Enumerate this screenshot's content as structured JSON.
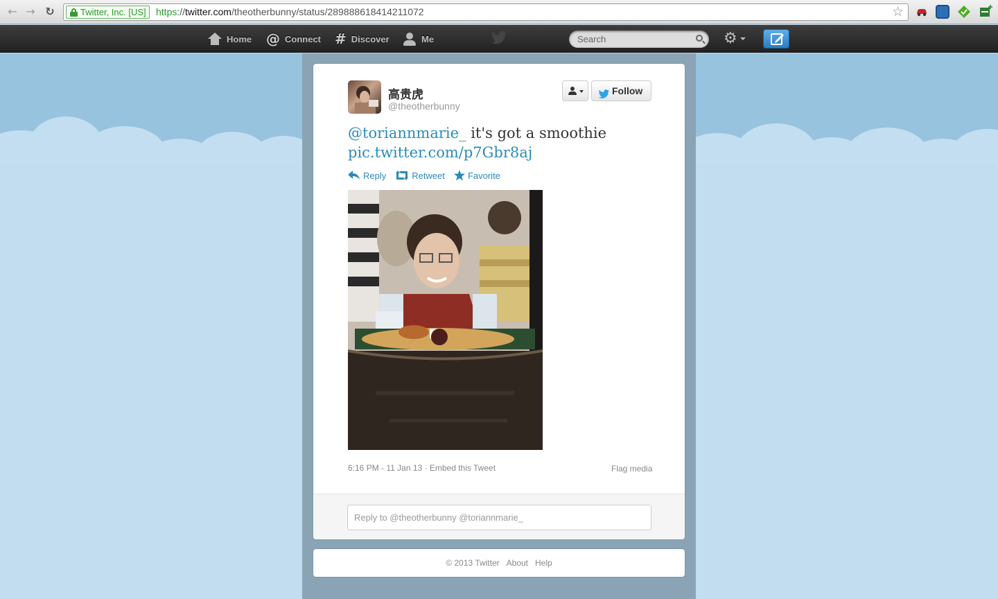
{
  "browser": {
    "ev_label": "Twitter, Inc. [US]",
    "url_scheme": "https",
    "url_sep": "://",
    "url_host": "twitter.com",
    "url_path": "/theotherbunny/status/289888618414211072"
  },
  "topnav": {
    "home": "Home",
    "connect": "Connect",
    "discover": "Discover",
    "me": "Me",
    "search_placeholder": "Search"
  },
  "tweet": {
    "fullname": "高贵虎",
    "screen_name": "@theotherbunny",
    "follow_label": "Follow",
    "mention": "@toriannmarie_",
    "text": " it's got a smoothie",
    "link": "pic.twitter.com/p7Gbr8aj",
    "actions": {
      "reply": "Reply",
      "retweet": "Retweet",
      "favorite": "Favorite"
    },
    "timestamp": "6:16 PM - 11 Jan 13",
    "separator": " · ",
    "embed": "Embed this Tweet",
    "flag": "Flag media",
    "reply_placeholder": "Reply to @theotherbunny @toriannmarie_"
  },
  "footer": {
    "copyright": "© 2013 Twitter",
    "about": "About",
    "help": "Help"
  },
  "colors": {
    "link_blue": "#2b8ab8",
    "topbar": "#2b2b2b",
    "sky": "#c0dcef"
  }
}
